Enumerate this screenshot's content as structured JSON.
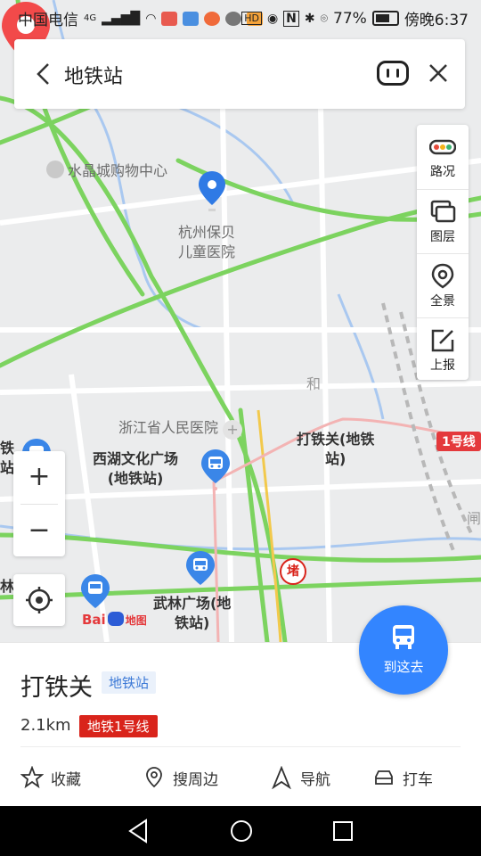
{
  "status_bar": {
    "carrier": "中国电信",
    "network": "4G",
    "battery": "77%",
    "time": "傍晚6:37",
    "hd": "HD",
    "n_label": "N"
  },
  "search": {
    "query": "地铁站"
  },
  "tools": [
    {
      "label": "路况"
    },
    {
      "label": "图层"
    },
    {
      "label": "全景"
    },
    {
      "label": "上报"
    }
  ],
  "zoom": {
    "plus": "+",
    "minus": "−"
  },
  "map_labels": {
    "mall": "水晶城购物中心",
    "hospital_child_1": "杭州保贝",
    "hospital_child_2": "儿童医院",
    "hospital_zhejiang": "浙江省人民医院",
    "xihu_1": "西湖文化广场",
    "xihu_2": "(地铁站)",
    "wulin_1": "武林广场(地",
    "wulin_2": "铁站)",
    "datieguan_1": "打铁关(地铁",
    "datieguan_2": "站)",
    "line_badge": "1号线",
    "red_pin": "堵",
    "partial_he": "和",
    "partial_left_1": "铁",
    "partial_left_2": "站",
    "partial_left_3": "林",
    "partial_right": "闸",
    "logo_bai": "Bai",
    "logo_ditu": "地图"
  },
  "go_button": {
    "label": "到这去"
  },
  "place": {
    "name": "打铁关",
    "category": "地铁站",
    "distance": "2.1km",
    "line": "地铁1号线"
  },
  "actions": [
    {
      "label": "收藏",
      "icon": "star-icon"
    },
    {
      "label": "搜周边",
      "icon": "location-pin-icon"
    },
    {
      "label": "导航",
      "icon": "navigation-arrow-icon"
    },
    {
      "label": "打车",
      "icon": "car-icon"
    }
  ],
  "colors": {
    "accent": "#3385ff",
    "metro_red": "#d9241b",
    "road_green": "#6fcf57",
    "pin_red": "#f24a4a"
  }
}
